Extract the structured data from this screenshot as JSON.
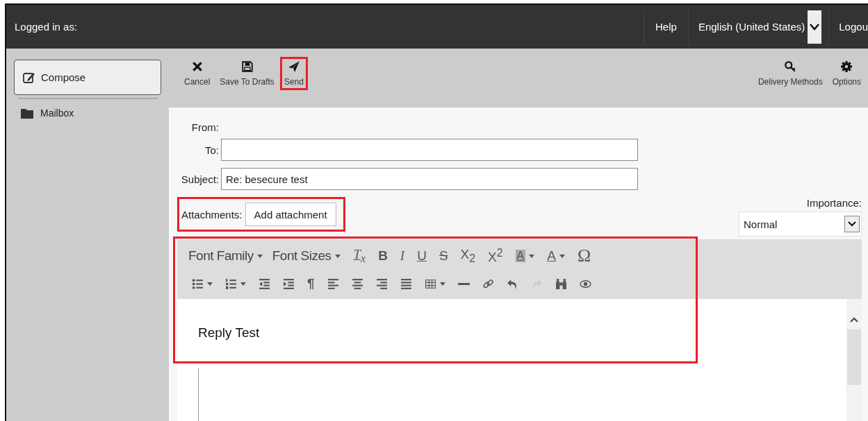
{
  "header": {
    "logged_in_label": "Logged in as:",
    "links": [
      {
        "label": "Help"
      }
    ],
    "language": {
      "value": "English (United States)"
    },
    "logout": "Logou"
  },
  "sidebar": {
    "compose": "Compose",
    "items": [
      {
        "label": "Mailbox"
      }
    ]
  },
  "toolbar": {
    "left": [
      {
        "label": "Cancel",
        "highlighted": false
      },
      {
        "label": "Save To Drafts",
        "highlighted": false
      },
      {
        "label": "Send",
        "highlighted": true
      }
    ],
    "right": [
      {
        "label": "Delivery Methods"
      },
      {
        "label": "Options"
      }
    ]
  },
  "form": {
    "from_label": "From:",
    "to": {
      "label": "To:"
    },
    "subject": {
      "label": "Subject:",
      "value": "Re: besecure test"
    },
    "attachments": {
      "label": "Attachments:",
      "button": "Add attachment",
      "highlighted": true
    },
    "importance": {
      "label": "Importance:",
      "value": "Normal"
    }
  },
  "editor": {
    "highlighted": true,
    "body": "Reply Test",
    "toolbar_rows": [
      [
        {
          "kind": "menu",
          "label": "Font Family"
        },
        {
          "kind": "menu",
          "label": "Font Sizes"
        },
        {
          "kind": "clear",
          "label": "T$_{x}$",
          "caret": false
        },
        {
          "kind": "bold",
          "label": "B",
          "caret": false
        },
        {
          "kind": "italic",
          "label": "I",
          "caret": false
        },
        {
          "kind": "underline",
          "label": "U",
          "caret": false
        },
        {
          "kind": "strike",
          "label": "S",
          "caret": false
        },
        {
          "kind": "plain",
          "label": "X$_{2}$",
          "caret": false
        },
        {
          "kind": "plain",
          "label": "X$^{2}$",
          "caret": false
        },
        {
          "kind": "highlight",
          "label": "A",
          "caret": true
        },
        {
          "kind": "underline",
          "label": "A",
          "caret": true
        },
        {
          "kind": "large",
          "label": "Ω",
          "caret": false
        }
      ],
      [
        {
          "kind": "icon",
          "caret": true,
          "disabled": false
        },
        {
          "kind": "icon",
          "caret": true,
          "disabled": false
        },
        {
          "kind": "icon",
          "caret": false,
          "disabled": false
        },
        {
          "kind": "icon",
          "caret": false,
          "disabled": false
        },
        {
          "kind": "bold",
          "label": "¶",
          "caret": false
        },
        {
          "kind": "icon",
          "caret": false,
          "disabled": false
        },
        {
          "kind": "icon",
          "caret": false,
          "disabled": false
        },
        {
          "kind": "icon",
          "caret": false,
          "disabled": false
        },
        {
          "kind": "icon",
          "caret": false,
          "disabled": false
        },
        {
          "kind": "icon",
          "caret": true,
          "disabled": false
        },
        {
          "kind": "icon",
          "caret": false,
          "disabled": false
        },
        {
          "kind": "icon",
          "caret": false,
          "disabled": false
        },
        {
          "kind": "icon",
          "caret": false,
          "disabled": false
        },
        {
          "kind": "icon",
          "caret": false,
          "disabled": true
        },
        {
          "kind": "icon",
          "caret": false,
          "disabled": false
        },
        {
          "kind": "icon",
          "caret": false,
          "disabled": false
        }
      ]
    ]
  }
}
